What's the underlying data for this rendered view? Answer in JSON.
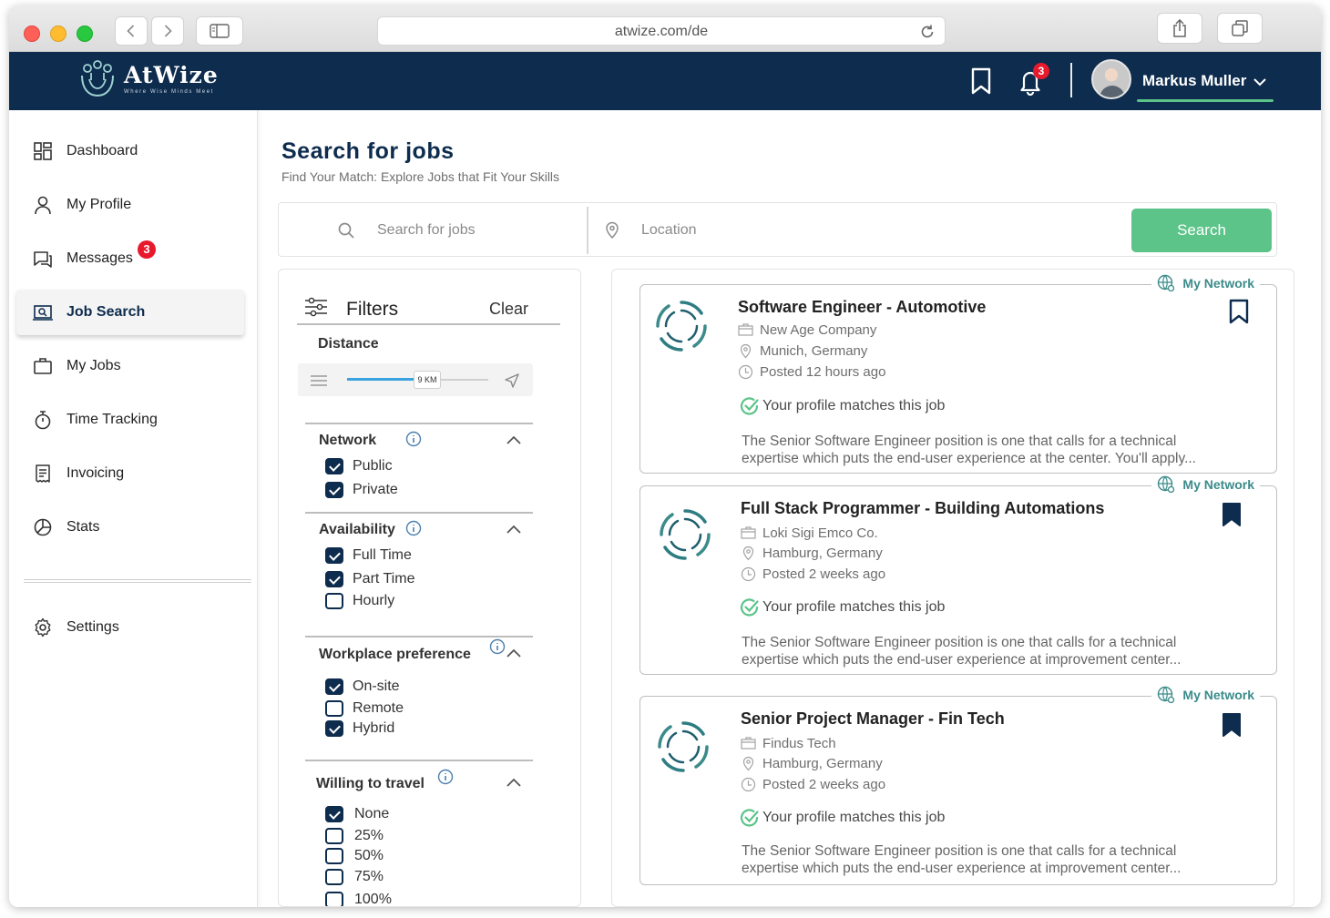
{
  "browser": {
    "url": "atwize.com/de"
  },
  "header": {
    "logo_name": "AtWize",
    "logo_tagline": "Where Wise Minds Meet",
    "notification_count": "3",
    "user_name": "Markus Muller"
  },
  "sidebar": {
    "items": [
      {
        "label": "Dashboard",
        "icon": "dashboard-icon"
      },
      {
        "label": "My Profile",
        "icon": "user-icon"
      },
      {
        "label": "Messages",
        "icon": "messages-icon",
        "badge": "3"
      },
      {
        "label": "Job Search",
        "icon": "job-search-icon",
        "active": true
      },
      {
        "label": "My Jobs",
        "icon": "briefcase-icon"
      },
      {
        "label": "Time Tracking",
        "icon": "stopwatch-icon"
      },
      {
        "label": "Invoicing",
        "icon": "invoice-icon"
      },
      {
        "label": "Stats",
        "icon": "pie-chart-icon"
      }
    ],
    "settings_label": "Settings"
  },
  "main": {
    "title": "Search for jobs",
    "subtitle": "Find Your Match: Explore Jobs that Fit Your Skills",
    "search": {
      "keyword_placeholder": "Search for jobs",
      "location_placeholder": "Location",
      "button_label": "Search"
    }
  },
  "filters": {
    "title": "Filters",
    "clear_label": "Clear",
    "distance": {
      "label": "Distance",
      "value_label": "9 KM",
      "fraction": 0.55
    },
    "network": {
      "label": "Network",
      "options": [
        {
          "label": "Public",
          "checked": true
        },
        {
          "label": "Private",
          "checked": true
        }
      ]
    },
    "availability": {
      "label": "Availability",
      "options": [
        {
          "label": "Full Time",
          "checked": true
        },
        {
          "label": "Part Time",
          "checked": true
        },
        {
          "label": "Hourly",
          "checked": false
        }
      ]
    },
    "workplace": {
      "label": "Workplace preference",
      "options": [
        {
          "label": "On-site",
          "checked": true
        },
        {
          "label": "Remote",
          "checked": false
        },
        {
          "label": "Hybrid",
          "checked": true
        }
      ]
    },
    "travel": {
      "label": "Willing to travel",
      "options": [
        {
          "label": "None",
          "checked": true
        },
        {
          "label": "25%",
          "checked": false
        },
        {
          "label": "50%",
          "checked": false
        },
        {
          "label": "75%",
          "checked": false
        },
        {
          "label": "100%",
          "checked": false
        }
      ]
    }
  },
  "jobs": [
    {
      "network_tag": "My Network",
      "title": "Software Engineer - Automotive",
      "company": "New Age Company",
      "location": "Munich, Germany",
      "posted": "Posted 12 hours ago",
      "match": "Your profile matches this job",
      "desc_line1": "The Senior Software Engineer position is one that calls for a technical",
      "desc_line2": "expertise which puts the end-user experience at the center. You'll apply...",
      "saved": false
    },
    {
      "network_tag": "My Network",
      "title": "Full Stack Programmer - Building Automations",
      "company": "Loki Sigi Emco Co.",
      "location": "Hamburg, Germany",
      "posted": "Posted 2 weeks ago",
      "match": "Your profile matches this job",
      "desc_line1": "The Senior Software Engineer position is one that calls for a technical",
      "desc_line2": "expertise which puts the end-user experience at improvement center...",
      "saved": true
    },
    {
      "network_tag": "My Network",
      "title": "Senior Project Manager -  Fin Tech",
      "company": "Findus Tech",
      "location": "Hamburg, Germany",
      "posted": "Posted 2 weeks ago",
      "match": "Your profile matches this job",
      "desc_line1": "The Senior Software Engineer position is one that calls for a technical",
      "desc_line2": "expertise which puts the end-user experience at improvement center...",
      "saved": true
    }
  ],
  "colors": {
    "navy": "#0d2c4e",
    "green": "#5cc489",
    "teal": "#3b8b8a",
    "badge_red": "#e8192c"
  }
}
